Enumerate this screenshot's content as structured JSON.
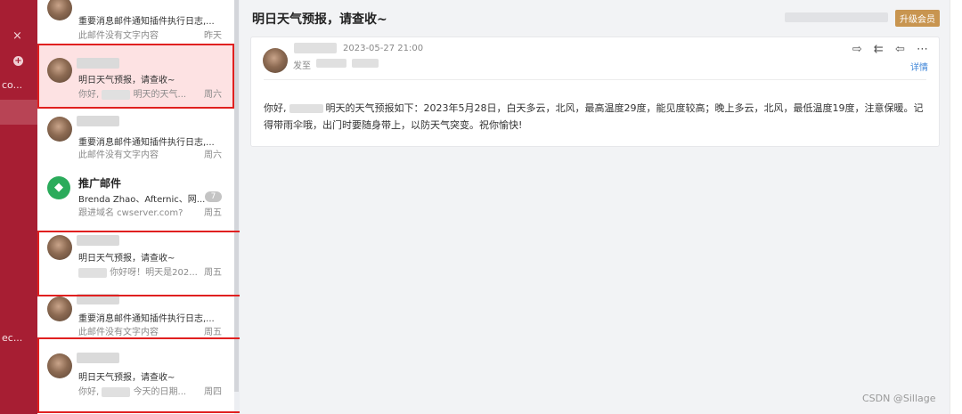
{
  "sidebar": {
    "close_icon": "×",
    "add_icon": "+",
    "text_upper": "co...",
    "text_lower": "ec..."
  },
  "mail_list": {
    "items": [
      {
        "subject": "重要消息邮件通知插件执行日志,...",
        "preview": "此邮件没有文字内容",
        "date": "昨天"
      },
      {
        "subject": "明日天气预报，请查收~",
        "preview_a": "你好,",
        "preview_b": "明天的天气...",
        "date": "周六"
      },
      {
        "subject": "重要消息邮件通知插件执行日志,...",
        "preview": "此邮件没有文字内容",
        "date": "周六"
      },
      {
        "title": "推广邮件",
        "subject": "Brenda Zhao、Afternic、网...",
        "count": "7",
        "preview": "跟进域名 cwserver.com?",
        "date": "周五"
      },
      {
        "subject": "明日天气预报，请查收~",
        "preview": "你好呀！明天是202...",
        "date": "周五"
      },
      {
        "subject": "重要消息邮件通知插件执行日志,...",
        "preview": "此邮件没有文字内容",
        "date": "周五"
      },
      {
        "subject": "明日天气预报，请查收~",
        "preview_a": "你好,",
        "preview_b": "今天的日期...",
        "date": "周四"
      }
    ]
  },
  "reading_pane": {
    "title": "明日天气预报，请查收~",
    "upgrade_label": "升级会员",
    "message": {
      "date": "2023-05-27 21:00",
      "to_label": "发至",
      "detail_label": "详情",
      "action_icons": [
        "forward-icon",
        "reply-all-icon",
        "reply-icon",
        "more-icon"
      ],
      "action_glyphs": [
        "⇨",
        "⇇",
        "⇦",
        "⋯"
      ],
      "body_greeting": "你好,",
      "body_text": "明天的天气预报如下：2023年5月28日，白天多云，北风，最高温度29度，能见度较高；晚上多云，北风，最低温度19度，注意保暖。记得带雨伞哦，出门时要随身带上，以防天气突变。祝你愉快!"
    }
  },
  "watermark": "CSDN @Sillage"
}
